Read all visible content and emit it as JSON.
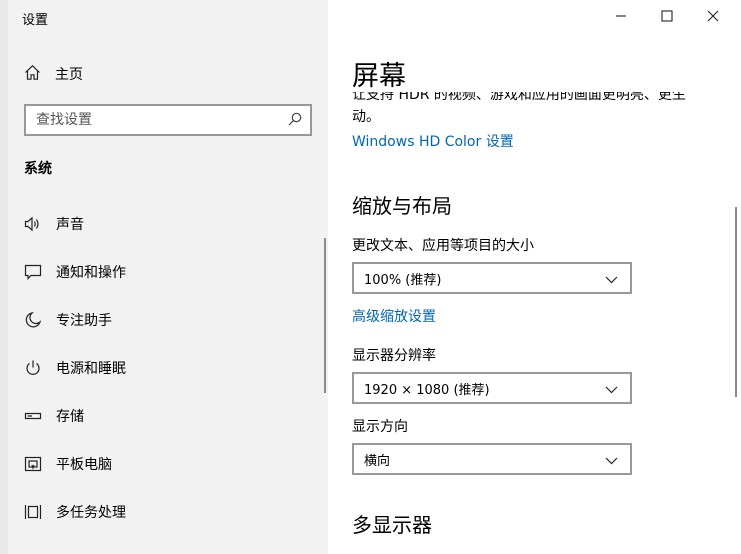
{
  "window": {
    "title": "设置"
  },
  "sidebar": {
    "home_label": "主页",
    "search": {
      "placeholder": "查找设置"
    },
    "section_title": "系统",
    "items": [
      {
        "label": "声音",
        "icon": "speaker-icon"
      },
      {
        "label": "通知和操作",
        "icon": "notification-icon"
      },
      {
        "label": "专注助手",
        "icon": "moon-icon"
      },
      {
        "label": "电源和睡眠",
        "icon": "power-icon"
      },
      {
        "label": "存储",
        "icon": "storage-icon"
      },
      {
        "label": "平板电脑",
        "icon": "tablet-icon"
      },
      {
        "label": "多任务处理",
        "icon": "multitasking-icon"
      }
    ]
  },
  "main": {
    "title": "屏幕",
    "hdr_text": "让支持 HDR 的视频、游戏和应用的画面更明亮、更生动。",
    "hdr_link": "Windows HD Color 设置",
    "scale_layout": {
      "heading": "缩放与布局",
      "text_size_label": "更改文本、应用等项目的大小",
      "text_size_value": "100% (推荐)",
      "advanced_link": "高级缩放设置",
      "resolution_label": "显示器分辨率",
      "resolution_value": "1920 × 1080 (推荐)",
      "orientation_label": "显示方向",
      "orientation_value": "横向"
    },
    "multi_display_heading": "多显示器"
  }
}
